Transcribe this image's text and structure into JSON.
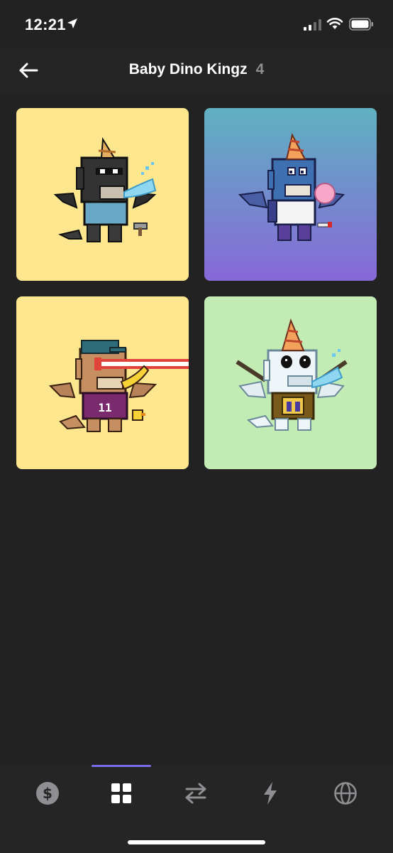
{
  "status": {
    "time": "12:21"
  },
  "header": {
    "title": "Baby Dino Kingz",
    "count": "4"
  },
  "nfts": [
    {
      "id": "nft-1",
      "background": "#fce68e"
    },
    {
      "id": "nft-2",
      "background_top": "#5fb1c1",
      "background_bottom": "#8768d8"
    },
    {
      "id": "nft-3",
      "background": "#fce68e"
    },
    {
      "id": "nft-4",
      "background": "#c3ebb4"
    }
  ],
  "tabs": [
    {
      "name": "tab-balances",
      "icon": "dollar-icon",
      "active": false
    },
    {
      "name": "tab-collectibles",
      "icon": "grid-icon",
      "active": true
    },
    {
      "name": "tab-swap",
      "icon": "swap-arrows-icon",
      "active": false
    },
    {
      "name": "tab-activity",
      "icon": "lightning-icon",
      "active": false
    },
    {
      "name": "tab-browser",
      "icon": "globe-icon",
      "active": false
    }
  ],
  "colors": {
    "accent": "#7a6ee8",
    "background": "#222222",
    "inactive_icon": "#8e8e93"
  }
}
